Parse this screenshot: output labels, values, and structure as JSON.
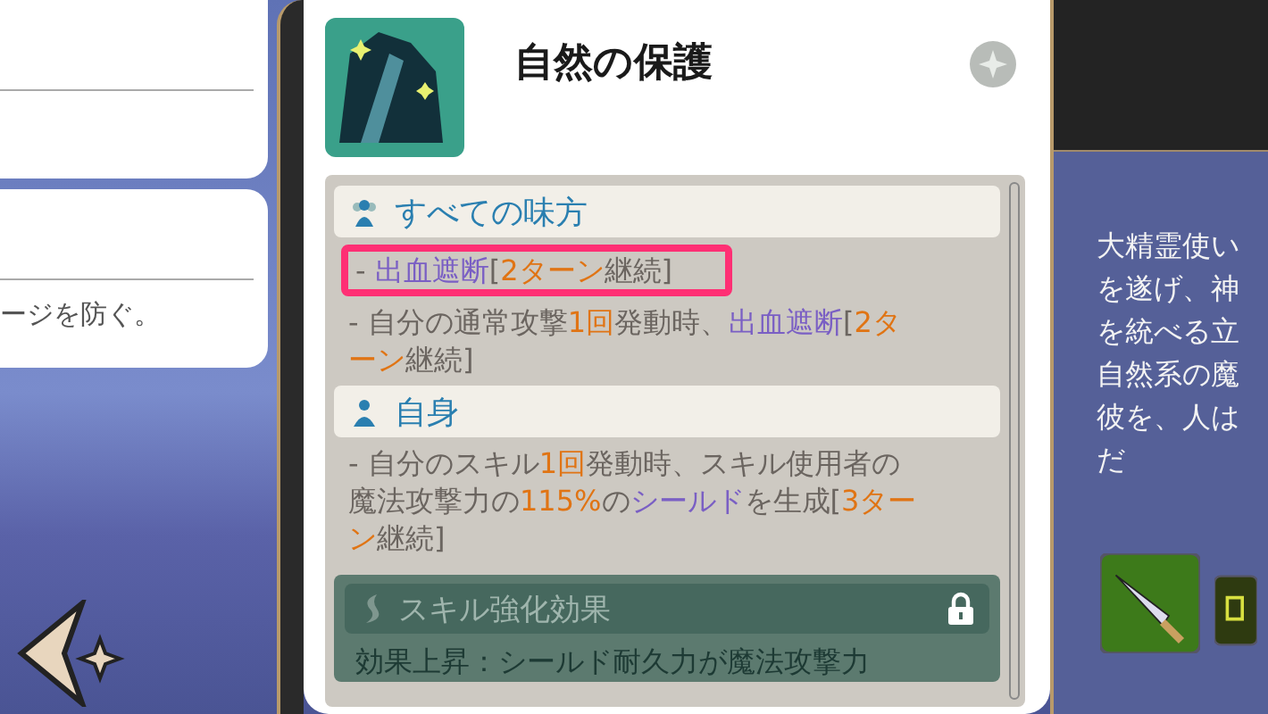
{
  "left_card": {
    "text": "ージを防ぐ。"
  },
  "skill": {
    "title": "自然の保護",
    "sections": [
      {
        "kind": "group",
        "heading": "すべての味方",
        "effects": [
          {
            "highlighted": true,
            "segments": [
              {
                "kind": "plain",
                "text": "- "
              },
              {
                "kind": "keyword",
                "text": "出血遮断"
              },
              {
                "kind": "plain",
                "text": "["
              },
              {
                "kind": "number",
                "text": "2ターン"
              },
              {
                "kind": "plain",
                "text": "継続]"
              }
            ]
          },
          {
            "highlighted": false,
            "segments": [
              {
                "kind": "plain",
                "text": "- 自分の通常攻撃"
              },
              {
                "kind": "number",
                "text": "1回"
              },
              {
                "kind": "plain",
                "text": "発動時、"
              },
              {
                "kind": "keyword",
                "text": "出血遮断"
              },
              {
                "kind": "plain",
                "text": "["
              },
              {
                "kind": "number",
                "text": "2ターン"
              },
              {
                "kind": "plain",
                "text": "継続]"
              }
            ]
          }
        ]
      },
      {
        "kind": "self",
        "heading": "自身",
        "effects": [
          {
            "highlighted": false,
            "segments": [
              {
                "kind": "plain",
                "text": "- 自分のスキル"
              },
              {
                "kind": "number",
                "text": "1回"
              },
              {
                "kind": "plain",
                "text": "発動時、スキル使用者の魔法攻撃力の"
              },
              {
                "kind": "number",
                "text": "115%"
              },
              {
                "kind": "plain",
                "text": "の"
              },
              {
                "kind": "keyword",
                "text": "シールド"
              },
              {
                "kind": "plain",
                "text": "を生成["
              },
              {
                "kind": "number",
                "text": "3ターン"
              },
              {
                "kind": "plain",
                "text": "継続]"
              }
            ]
          }
        ]
      }
    ],
    "enhancement": {
      "heading": "スキル強化効果",
      "locked": true,
      "text": "効果上昇：シールド耐久力が魔法攻撃力"
    }
  },
  "lore": [
    "大精霊使い",
    "を遂げ、神",
    "を統べる立",
    "自然系の魔",
    "彼を、人は",
    "だ"
  ]
}
